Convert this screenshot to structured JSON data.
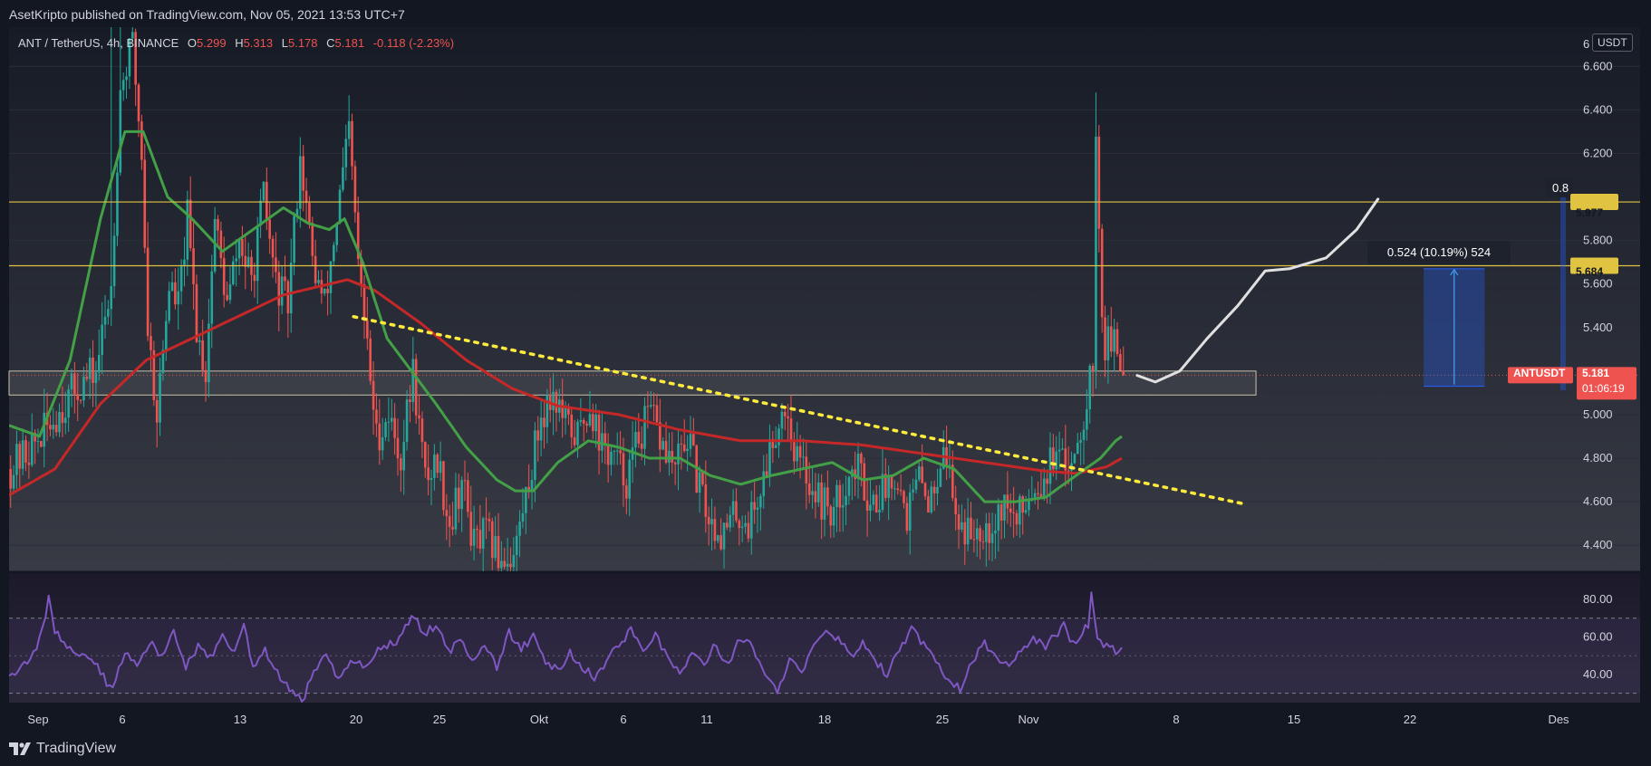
{
  "header": {
    "published_text": "AsetKripto published on TradingView.com, Nov 05, 2021 13:53 UTC+7"
  },
  "legend": {
    "symbol": "ANT / TetherUS, 4h, BINANCE",
    "open_label": "O",
    "open": "5.299",
    "high_label": "H",
    "high": "5.313",
    "low_label": "L",
    "low": "5.178",
    "close_label": "C",
    "close": "5.181",
    "change": "-0.118 (-2.23%)"
  },
  "price_axis": {
    "unit": "USDT",
    "ticks": [
      "6.600",
      "6.400",
      "6.200",
      "5.800",
      "5.600",
      "5.400",
      "5.000",
      "4.800",
      "4.600",
      "4.400"
    ],
    "partial_top_label": "6",
    "partial_label": "0.8"
  },
  "levels": {
    "resistance_high": "5.977",
    "resistance_low": "5.684",
    "level_color": "#e0c341",
    "badge_text_color": "#131722"
  },
  "current_price": {
    "symbol": "ANTUSDT",
    "price": "5.181",
    "countdown": "01:06:19",
    "color": "#ef5350"
  },
  "measure": {
    "label": "0.524 (10.19%) 524"
  },
  "rsi_axis": {
    "ticks": [
      "80.00",
      "60.00",
      "40.00"
    ]
  },
  "time_axis": {
    "labels": [
      "Sep",
      "6",
      "13",
      "20",
      "25",
      "Okt",
      "6",
      "11",
      "18",
      "25",
      "Nov",
      "8",
      "15",
      "22",
      "Des"
    ]
  },
  "footer": {
    "brand": "TradingView"
  },
  "chart_data": {
    "type": "candlestick",
    "title": "ANT / TetherUS, 4h, BINANCE",
    "ylim": [
      4.28,
      6.78
    ],
    "rsi_ylim": [
      25,
      94
    ],
    "colors": {
      "up": "#26a69a",
      "down": "#ef5350",
      "sma_fast": "#43a047",
      "sma_slow": "#c62828",
      "rsi": "#7e57c2",
      "trendline": "#ffeb3b",
      "projection": "#e0e0e0"
    },
    "close_anchors": [
      [
        0,
        4.75
      ],
      [
        10,
        4.9
      ],
      [
        20,
        5.1
      ],
      [
        28,
        5.2
      ],
      [
        33,
        5.6
      ],
      [
        36,
        6.5
      ],
      [
        40,
        6.7
      ],
      [
        43,
        6.2
      ],
      [
        45,
        5.4
      ],
      [
        48,
        5.0
      ],
      [
        52,
        5.6
      ],
      [
        55,
        5.5
      ],
      [
        58,
        5.9
      ],
      [
        61,
        5.4
      ],
      [
        64,
        5.2
      ],
      [
        67,
        5.9
      ],
      [
        71,
        5.5
      ],
      [
        75,
        5.8
      ],
      [
        79,
        5.6
      ],
      [
        83,
        6.0
      ],
      [
        87,
        5.6
      ],
      [
        91,
        5.5
      ],
      [
        95,
        6.2
      ],
      [
        99,
        5.7
      ],
      [
        103,
        5.5
      ],
      [
        107,
        5.9
      ],
      [
        111,
        6.3
      ],
      [
        114,
        5.7
      ],
      [
        117,
        5.3
      ],
      [
        120,
        4.9
      ],
      [
        124,
        5.0
      ],
      [
        128,
        4.8
      ],
      [
        132,
        5.2
      ],
      [
        136,
        4.7
      ],
      [
        140,
        4.8
      ],
      [
        144,
        4.5
      ],
      [
        148,
        4.7
      ],
      [
        152,
        4.4
      ],
      [
        156,
        4.45
      ],
      [
        160,
        4.35
      ],
      [
        165,
        4.35
      ],
      [
        170,
        4.7
      ],
      [
        174,
        5.0
      ],
      [
        178,
        5.1
      ],
      [
        182,
        4.95
      ],
      [
        186,
        4.9
      ],
      [
        190,
        5.05
      ],
      [
        194,
        4.85
      ],
      [
        198,
        4.8
      ],
      [
        202,
        4.7
      ],
      [
        206,
        4.9
      ],
      [
        210,
        5.0
      ],
      [
        214,
        4.85
      ],
      [
        218,
        4.75
      ],
      [
        222,
        4.9
      ],
      [
        226,
        4.65
      ],
      [
        230,
        4.5
      ],
      [
        234,
        4.45
      ],
      [
        238,
        4.55
      ],
      [
        242,
        4.5
      ],
      [
        246,
        4.65
      ],
      [
        250,
        4.9
      ],
      [
        254,
        5.05
      ],
      [
        258,
        4.8
      ],
      [
        262,
        4.7
      ],
      [
        266,
        4.6
      ],
      [
        270,
        4.55
      ],
      [
        274,
        4.7
      ],
      [
        278,
        4.75
      ],
      [
        282,
        4.6
      ],
      [
        286,
        4.65
      ],
      [
        290,
        4.75
      ],
      [
        294,
        4.55
      ],
      [
        298,
        4.7
      ],
      [
        302,
        4.6
      ],
      [
        306,
        4.9
      ],
      [
        310,
        4.55
      ],
      [
        314,
        4.45
      ],
      [
        318,
        4.5
      ],
      [
        322,
        4.5
      ],
      [
        326,
        4.6
      ],
      [
        330,
        4.5
      ],
      [
        334,
        4.65
      ],
      [
        338,
        4.7
      ],
      [
        342,
        4.8
      ],
      [
        346,
        4.75
      ],
      [
        350,
        4.9
      ],
      [
        352,
        5.0
      ],
      [
        354,
        5.2
      ],
      [
        355,
        5.25
      ],
      [
        356,
        6.2
      ],
      [
        357,
        5.9
      ],
      [
        358,
        5.5
      ],
      [
        359,
        5.3
      ],
      [
        361,
        5.35
      ],
      [
        363,
        5.26
      ],
      [
        365,
        5.18
      ]
    ],
    "sma_fast": [
      [
        0,
        4.95
      ],
      [
        10,
        4.9
      ],
      [
        20,
        5.25
      ],
      [
        30,
        5.9
      ],
      [
        38,
        6.3
      ],
      [
        44,
        6.3
      ],
      [
        52,
        6.0
      ],
      [
        60,
        5.9
      ],
      [
        70,
        5.75
      ],
      [
        80,
        5.85
      ],
      [
        90,
        5.95
      ],
      [
        98,
        5.88
      ],
      [
        105,
        5.85
      ],
      [
        110,
        5.9
      ],
      [
        116,
        5.7
      ],
      [
        124,
        5.35
      ],
      [
        132,
        5.2
      ],
      [
        140,
        5.05
      ],
      [
        150,
        4.85
      ],
      [
        160,
        4.7
      ],
      [
        166,
        4.65
      ],
      [
        172,
        4.65
      ],
      [
        180,
        4.78
      ],
      [
        190,
        4.88
      ],
      [
        200,
        4.85
      ],
      [
        210,
        4.8
      ],
      [
        220,
        4.8
      ],
      [
        230,
        4.72
      ],
      [
        240,
        4.68
      ],
      [
        250,
        4.72
      ],
      [
        260,
        4.75
      ],
      [
        270,
        4.78
      ],
      [
        280,
        4.7
      ],
      [
        290,
        4.72
      ],
      [
        300,
        4.8
      ],
      [
        310,
        4.75
      ],
      [
        320,
        4.6
      ],
      [
        330,
        4.6
      ],
      [
        340,
        4.62
      ],
      [
        350,
        4.72
      ],
      [
        358,
        4.8
      ],
      [
        363,
        4.88
      ],
      [
        365,
        4.9
      ]
    ],
    "sma_slow": [
      [
        0,
        4.63
      ],
      [
        15,
        4.75
      ],
      [
        30,
        5.05
      ],
      [
        45,
        5.25
      ],
      [
        60,
        5.35
      ],
      [
        75,
        5.45
      ],
      [
        90,
        5.55
      ],
      [
        105,
        5.6
      ],
      [
        111,
        5.62
      ],
      [
        120,
        5.57
      ],
      [
        135,
        5.42
      ],
      [
        150,
        5.25
      ],
      [
        165,
        5.12
      ],
      [
        180,
        5.04
      ],
      [
        200,
        5.0
      ],
      [
        220,
        4.93
      ],
      [
        240,
        4.88
      ],
      [
        260,
        4.88
      ],
      [
        280,
        4.86
      ],
      [
        300,
        4.82
      ],
      [
        320,
        4.78
      ],
      [
        340,
        4.74
      ],
      [
        350,
        4.73
      ],
      [
        360,
        4.76
      ],
      [
        365,
        4.8
      ]
    ],
    "rsi": [
      [
        0,
        40
      ],
      [
        5,
        45
      ],
      [
        10,
        58
      ],
      [
        13,
        80
      ],
      [
        15,
        62
      ],
      [
        20,
        55
      ],
      [
        25,
        48
      ],
      [
        30,
        42
      ],
      [
        33,
        32
      ],
      [
        35,
        38
      ],
      [
        38,
        52
      ],
      [
        42,
        44
      ],
      [
        46,
        58
      ],
      [
        50,
        48
      ],
      [
        54,
        62
      ],
      [
        58,
        44
      ],
      [
        62,
        56
      ],
      [
        66,
        48
      ],
      [
        70,
        60
      ],
      [
        74,
        52
      ],
      [
        77,
        66
      ],
      [
        80,
        44
      ],
      [
        84,
        52
      ],
      [
        88,
        40
      ],
      [
        92,
        32
      ],
      [
        96,
        26
      ],
      [
        100,
        40
      ],
      [
        104,
        50
      ],
      [
        108,
        38
      ],
      [
        112,
        48
      ],
      [
        116,
        44
      ],
      [
        120,
        52
      ],
      [
        124,
        56
      ],
      [
        128,
        58
      ],
      [
        132,
        72
      ],
      [
        136,
        62
      ],
      [
        140,
        66
      ],
      [
        144,
        52
      ],
      [
        148,
        58
      ],
      [
        152,
        48
      ],
      [
        156,
        56
      ],
      [
        160,
        44
      ],
      [
        164,
        62
      ],
      [
        168,
        54
      ],
      [
        172,
        60
      ],
      [
        176,
        46
      ],
      [
        180,
        42
      ],
      [
        184,
        52
      ],
      [
        188,
        44
      ],
      [
        192,
        38
      ],
      [
        196,
        48
      ],
      [
        200,
        56
      ],
      [
        204,
        64
      ],
      [
        208,
        54
      ],
      [
        212,
        60
      ],
      [
        216,
        50
      ],
      [
        220,
        40
      ],
      [
        224,
        52
      ],
      [
        228,
        46
      ],
      [
        232,
        56
      ],
      [
        236,
        44
      ],
      [
        240,
        60
      ],
      [
        244,
        54
      ],
      [
        248,
        38
      ],
      [
        252,
        32
      ],
      [
        256,
        48
      ],
      [
        260,
        40
      ],
      [
        264,
        56
      ],
      [
        268,
        62
      ],
      [
        272,
        58
      ],
      [
        276,
        50
      ],
      [
        280,
        56
      ],
      [
        284,
        48
      ],
      [
        288,
        40
      ],
      [
        292,
        52
      ],
      [
        296,
        64
      ],
      [
        300,
        56
      ],
      [
        304,
        46
      ],
      [
        308,
        38
      ],
      [
        312,
        32
      ],
      [
        316,
        48
      ],
      [
        320,
        56
      ],
      [
        324,
        50
      ],
      [
        328,
        44
      ],
      [
        332,
        52
      ],
      [
        336,
        60
      ],
      [
        340,
        55
      ],
      [
        344,
        62
      ],
      [
        346,
        68
      ],
      [
        348,
        60
      ],
      [
        350,
        58
      ],
      [
        354,
        66
      ],
      [
        355,
        84
      ],
      [
        357,
        60
      ],
      [
        360,
        55
      ],
      [
        363,
        52
      ],
      [
        365,
        52
      ]
    ],
    "trendline": {
      "start": [
        113,
        5.45
      ],
      "end": [
        405,
        4.59
      ]
    },
    "support_zone": {
      "from_index": 0,
      "to_index": 409,
      "y_top": 5.2,
      "y_bottom": 5.09
    },
    "projection": [
      [
        370,
        5.18
      ],
      [
        376,
        5.15
      ],
      [
        384,
        5.2
      ],
      [
        393,
        5.35
      ],
      [
        403,
        5.5
      ],
      [
        412,
        5.66
      ],
      [
        420,
        5.67
      ],
      [
        432,
        5.72
      ],
      [
        442,
        5.85
      ],
      [
        449,
        5.99
      ]
    ],
    "measure_box": {
      "from_index": 464,
      "to_index": 484,
      "y_bottom": 5.13,
      "y_top": 5.67
    },
    "rsi_levels": [
      70,
      50,
      30
    ]
  }
}
